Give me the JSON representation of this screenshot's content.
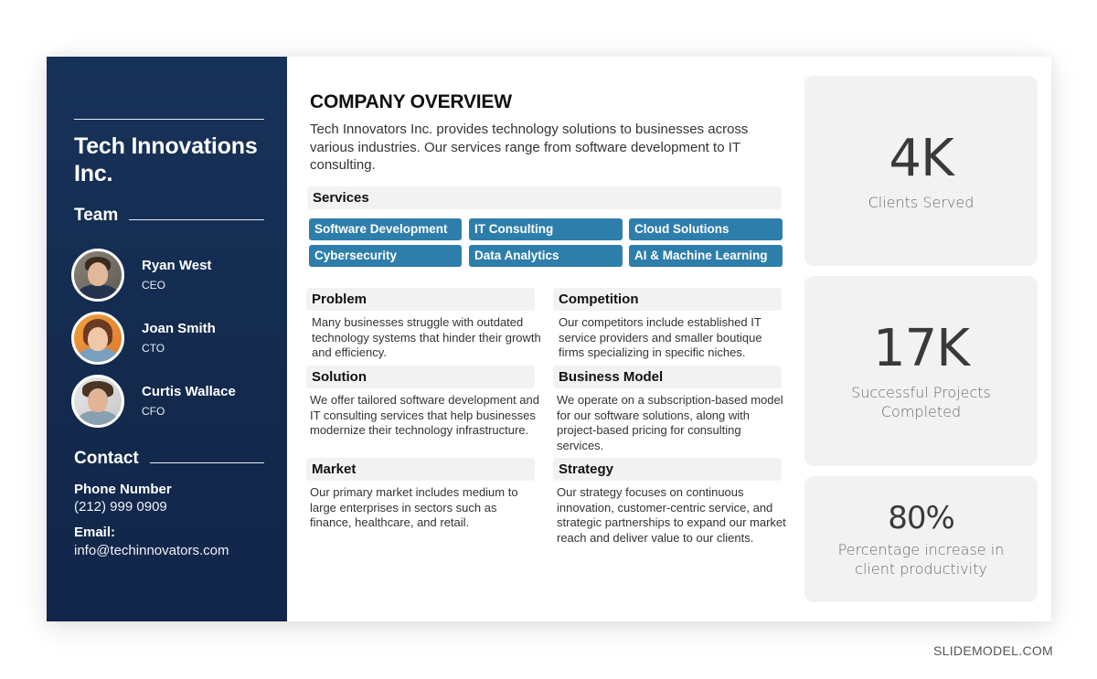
{
  "sidebar": {
    "company_name": "Tech Innovations Inc.",
    "team_heading": "Team",
    "team": [
      {
        "name": "Ryan West",
        "role": "CEO",
        "avatar": "person-photo"
      },
      {
        "name": "Joan Smith",
        "role": "CTO",
        "avatar": "person-photo"
      },
      {
        "name": "Curtis Wallace",
        "role": "CFO",
        "avatar": "person-photo"
      }
    ],
    "contact_heading": "Contact",
    "phone_label": "Phone Number",
    "phone_value": "(212) 999 0909",
    "email_label": "Email:",
    "email_value": "info@techinnovators.com"
  },
  "overview": {
    "title": "COMPANY OVERVIEW",
    "description": "Tech Innovators Inc. provides technology solutions to  businesses across various industries. Our services range from software development to IT consulting."
  },
  "services": {
    "heading": "Services",
    "items": [
      "Software Development",
      "IT Consulting",
      "Cloud Solutions",
      "Cybersecurity",
      "Data Analytics",
      "AI & Machine Learning"
    ],
    "chip_color": "#2e7eac"
  },
  "blocks": {
    "problem": {
      "title": "Problem",
      "text": "Many businesses struggle with outdated technology systems that hinder their growth and efficiency."
    },
    "solution": {
      "title": "Solution",
      "text": "We offer tailored software development and IT consulting services that help businesses modernize their technology infrastructure."
    },
    "market": {
      "title": "Market",
      "text": "Our primary market includes medium to large enterprises in sectors such as finance, healthcare, and retail."
    },
    "competition": {
      "title": "Competition",
      "text": "Our competitors include established IT service providers and smaller boutique firms specializing in specific niches."
    },
    "business_model": {
      "title": "Business Model",
      "text": "We operate on a subscription-based model for our software solutions, along with project-based pricing for consulting services."
    },
    "strategy": {
      "title": "Strategy",
      "text": "Our strategy focuses on continuous innovation, customer-centric service, and strategic partnerships to expand our market reach and deliver value to our clients."
    }
  },
  "stats": [
    {
      "value": "4K",
      "label": "Clients Served"
    },
    {
      "value": "17K",
      "label": "Successful Projects Completed"
    },
    {
      "value": "80%",
      "label": "Percentage increase in client productivity"
    }
  ],
  "colors": {
    "sidebar_bg": "#152d54",
    "card_bg": "#f2f2f2"
  },
  "watermark": "SLIDEMODEL.COM"
}
